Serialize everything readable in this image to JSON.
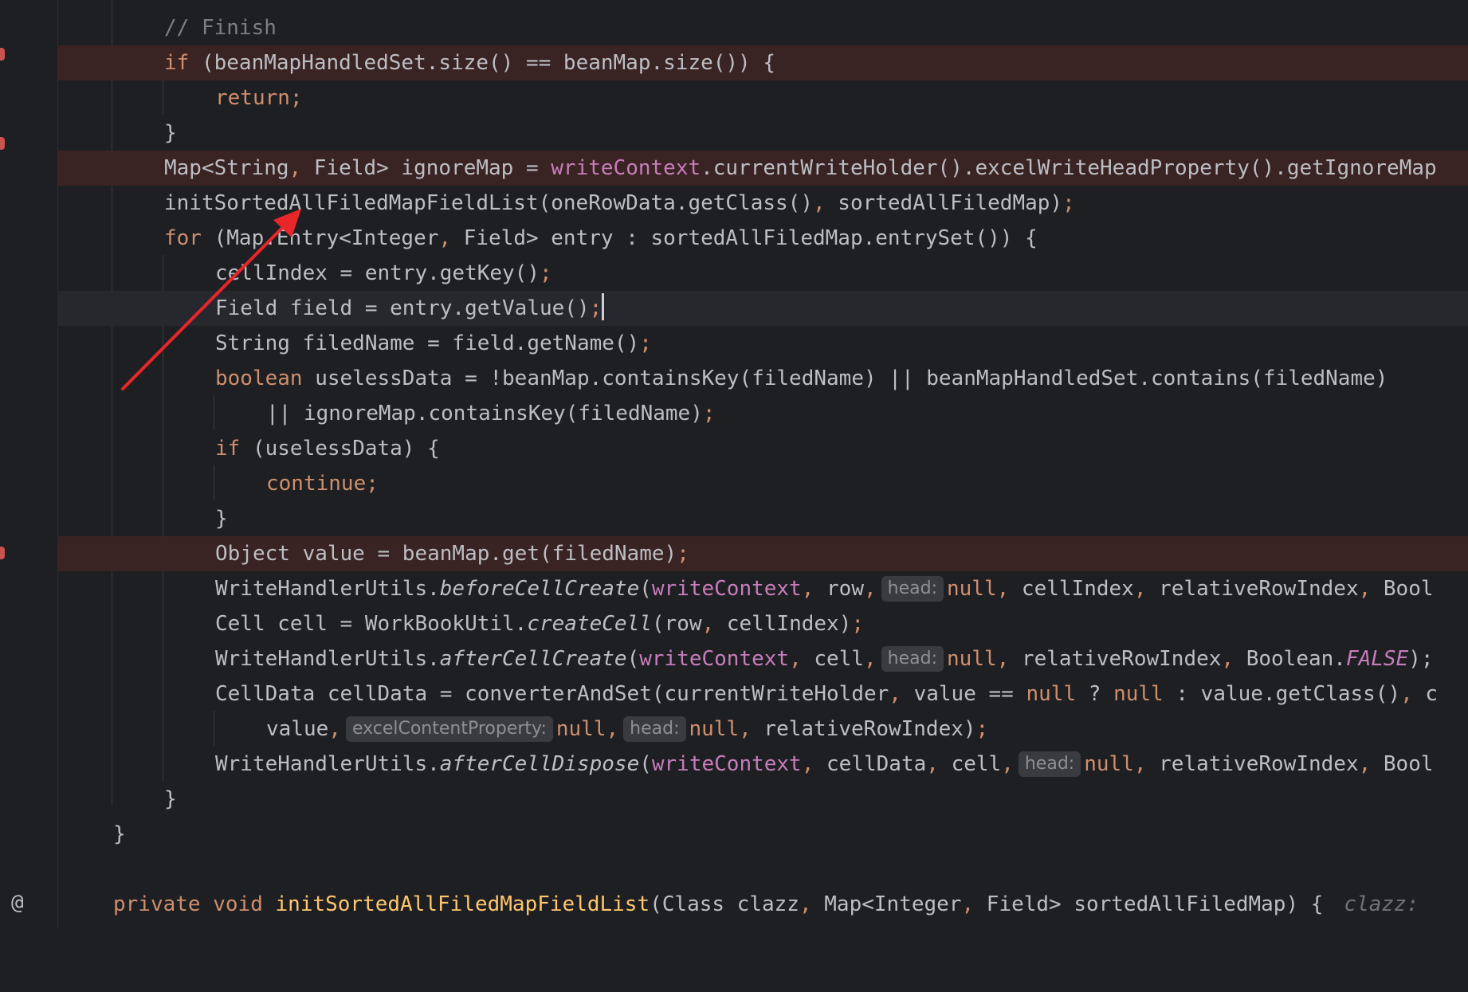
{
  "gutter": {
    "at_symbol": "@"
  },
  "hints": {
    "head": "head:",
    "excel_content_property": "excelContentProperty:",
    "clazz": "clazz:"
  },
  "code": {
    "l1": {
      "a": "// Finish"
    },
    "l2": {
      "a": "if",
      "b": " (beanMapHandledSet.size() == beanMap.size()) {"
    },
    "l3": {
      "a": "return;"
    },
    "l4": {
      "a": "}"
    },
    "l5": {
      "a": "Map<String",
      "b": ",",
      "c": " Field> ignoreMap = ",
      "d": "writeContext",
      "e": ".currentWriteHolder().excelWriteHeadProperty().getIgnoreMap"
    },
    "l6": {
      "a": "initSortedAllFiledMapFieldList(oneRowData.getClass()",
      "b": ",",
      "c": " sortedAllFiledMap)",
      "d": ";"
    },
    "l7": {
      "a": "for",
      "b": " (Map.Entry<Integer",
      "c": ",",
      "d": " Field> entry : sortedAllFiledMap.entrySet()) {"
    },
    "l8": {
      "a": "cellIndex = entry.getKey()",
      "b": ";"
    },
    "l9": {
      "a": "Field field = entry.getValue()",
      "b": ";"
    },
    "l10": {
      "a": "String filedName = field.getName()",
      "b": ";"
    },
    "l11": {
      "a": "boolean",
      "b": " uselessData = !beanMap.containsKey(filedName) || beanMapHandledSet.contains(filedName)"
    },
    "l12": {
      "a": "|| ignoreMap.containsKey(filedName)",
      "b": ";"
    },
    "l13": {
      "a": "if",
      "b": " (uselessData) {"
    },
    "l14": {
      "a": "continue;"
    },
    "l15": {
      "a": "}"
    },
    "l16": {
      "a": "Object value = beanMap.get(filedName)",
      "b": ";"
    },
    "l17": {
      "a": "WriteHandlerUtils.",
      "b": "beforeCellCreate",
      "c": "(",
      "d": "writeContext",
      "e": ",",
      "f": " row",
      "g": ",",
      "h": "null",
      "i": ",",
      "j": " cellIndex",
      "k": ",",
      "l": " relativeRowIndex",
      "m": ",",
      "n": " Bool"
    },
    "l18": {
      "a": "Cell cell = WorkBookUtil.",
      "b": "createCell",
      "c": "(row",
      "d": ",",
      "e": " cellIndex)",
      "f": ";"
    },
    "l19": {
      "a": "WriteHandlerUtils.",
      "b": "afterCellCreate",
      "c": "(",
      "d": "writeContext",
      "e": ",",
      "f": " cell",
      "g": ",",
      "h": "null",
      "i": ",",
      "j": " relativeRowIndex",
      "k": ",",
      "l": " Boolean.",
      "m": "FALSE",
      "n": ");"
    },
    "l20": {
      "a": "CellData cellData = converterAndSet(currentWriteHolder",
      "b": ",",
      "c": " value == ",
      "d": "null",
      "e": " ? ",
      "f": "null",
      "g": " : value.getClass()",
      "h": ",",
      "i": " c"
    },
    "l21": {
      "a": "value",
      "b": ",",
      "c": "null",
      "d": ",",
      "e": "null",
      "f": ",",
      "g": " relativeRowIndex)",
      "h": ";"
    },
    "l22": {
      "a": "WriteHandlerUtils.",
      "b": "afterCellDispose",
      "c": "(",
      "d": "writeContext",
      "e": ",",
      "f": " cellData",
      "g": ",",
      "h": " cell",
      "i": ",",
      "j": "null",
      "k": ",",
      "l": " relativeRowIndex",
      "m": ",",
      "n": " Bool"
    },
    "l23": {
      "a": "}"
    },
    "l24": {
      "a": "}"
    },
    "l26": {
      "a": "private",
      "b": " ",
      "c": "void",
      "d": " ",
      "e": "initSortedAllFiledMapFieldList",
      "f": "(Class clazz",
      "g": ",",
      "h": " Map<Integer",
      "i": ",",
      "j": " Field> sortedAllFiledMap) {"
    }
  },
  "colors": {
    "background": "#1e1f22",
    "keyword": "#cf8e6d",
    "field": "#c77dbb",
    "breakpoint_line": "#3a2323",
    "annotation_arrow": "#e8262a"
  }
}
